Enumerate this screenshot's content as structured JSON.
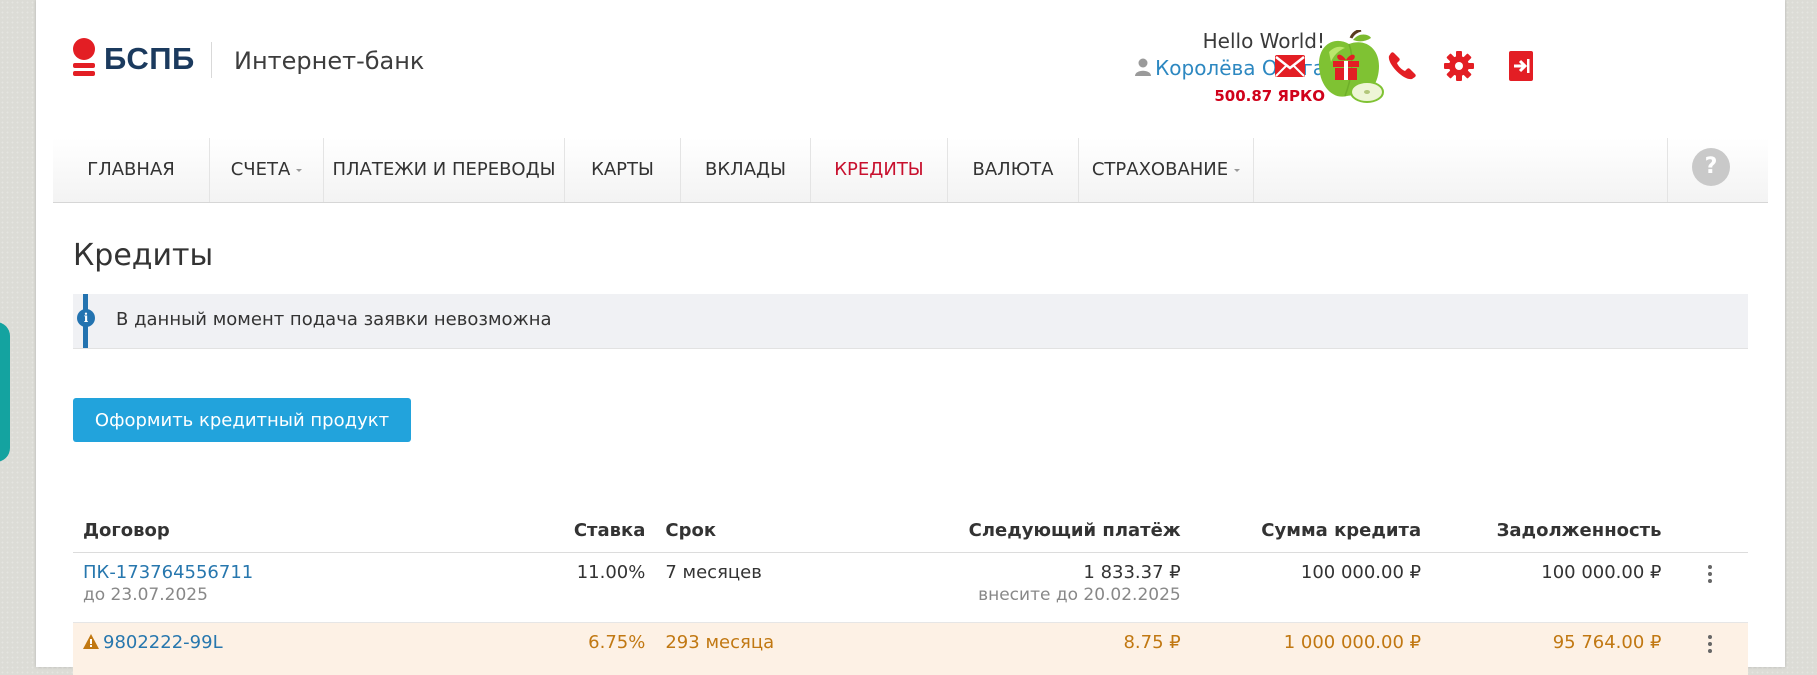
{
  "header": {
    "logo_text": "БСПБ",
    "app_name": "Интернет-банк",
    "greeting": "Hello World!",
    "user_name": "Королёва Ольга",
    "bonus_balance": "500.87 ЯРКО",
    "icons": [
      "mail-icon",
      "gift-icon",
      "phone-icon",
      "gear-icon",
      "logout-icon"
    ]
  },
  "nav": {
    "items": [
      {
        "label": "ГЛАВНАЯ"
      },
      {
        "label": "СЧЕТА"
      },
      {
        "label": "ПЛАТЕЖИ И ПЕРЕВОДЫ"
      },
      {
        "label": "КАРТЫ"
      },
      {
        "label": "ВКЛАДЫ"
      },
      {
        "label": "КРЕДИТЫ"
      },
      {
        "label": "ВАЛЮТА"
      },
      {
        "label": "СТРАХОВАНИЕ"
      }
    ],
    "active": "КРЕДИТЫ",
    "help": "?"
  },
  "page": {
    "title": "Кредиты",
    "notice": "В данный момент подача заявки невозможна",
    "apply_button": "Оформить кредитный продукт"
  },
  "table": {
    "columns": [
      "Договор",
      "Ставка",
      "Срок",
      "Следующий платёж",
      "Сумма кредита",
      "Задолженность"
    ],
    "rows": [
      {
        "contract": "ПК-173764556711",
        "contract_sub": "до 23.07.2025",
        "rate": "11.00%",
        "term": "7 месяцев",
        "next_payment": "1 833.37 ₽",
        "next_payment_sub": "внесите до 20.02.2025",
        "amount": "100 000.00 ₽",
        "debt": "100 000.00 ₽"
      },
      {
        "contract": "9802222-99L",
        "rate": "6.75%",
        "term": "293 месяца",
        "next_payment": "8.75 ₽",
        "amount": "1 000 000.00 ₽",
        "debt": "95 764.00 ₽",
        "warning": true
      }
    ]
  },
  "colors": {
    "brand_red": "#e31e24",
    "link_blue": "#2777ae",
    "button_blue": "#22a3dc",
    "warning_orange": "#c17812"
  }
}
